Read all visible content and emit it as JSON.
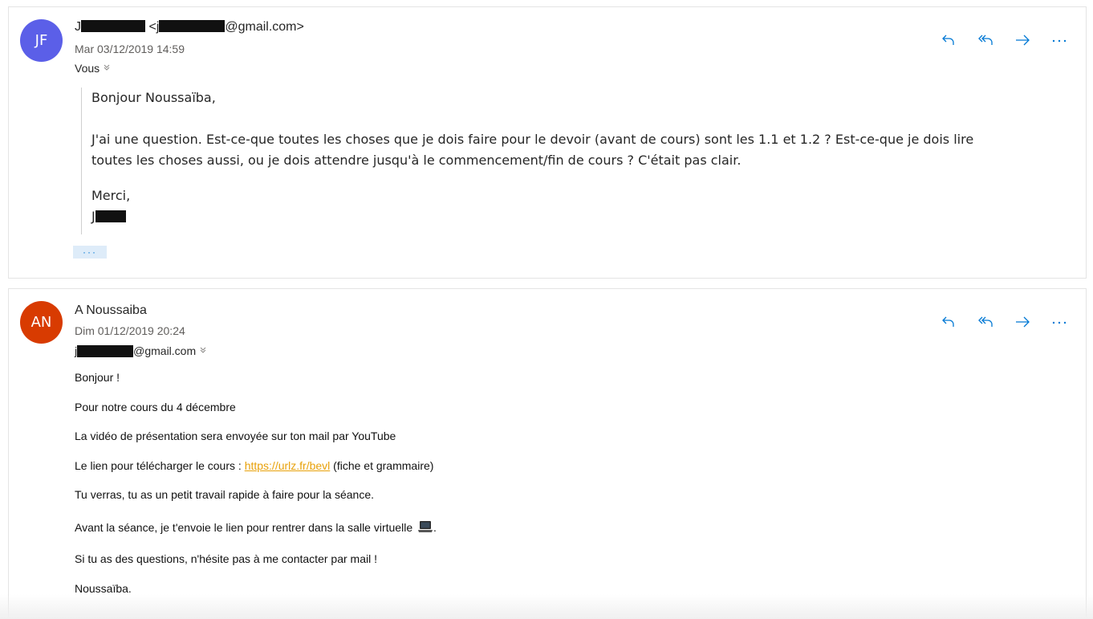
{
  "colors": {
    "accent": "#0078d4",
    "avatar1": "#5b5fe8",
    "avatar2": "#d83b01",
    "link": "#e8a10a"
  },
  "message1": {
    "avatar_initials": "JF",
    "sender_name_prefix": "J",
    "sender_email_prefix": "<j",
    "sender_email_suffix": "@gmail.com>",
    "date": "Mar 03/12/2019 14:59",
    "to_label": "Vous",
    "body": {
      "greeting": "Bonjour Noussaïba,",
      "line1": "J'ai une question. Est-ce-que toutes les choses que je dois faire pour le devoir (avant de cours) sont les 1.1 et 1.2 ? Est-ce-que je dois lire",
      "line2": "toutes les choses aussi, ou je dois attendre jusqu'à le commencement/fin de cours ? C'était pas clair.",
      "signoff": "Merci,",
      "signature_prefix": "J"
    },
    "more_label": "···",
    "actions": [
      "reply-icon",
      "reply-all-icon",
      "forward-icon",
      "more-icon"
    ]
  },
  "message2": {
    "avatar_initials": "AN",
    "sender": "A Noussaiba",
    "date": "Dim 01/12/2019 20:24",
    "to_prefix": "j",
    "to_suffix": "@gmail.com",
    "body": {
      "l1": "Bonjour !",
      "l2": "Pour notre cours du 4 décembre",
      "l3": "La vidéo de présentation sera envoyée sur ton mail par YouTube",
      "l4_prefix": "Le lien pour télécharger le cours : ",
      "l4_link": "https://urlz.fr/bevl",
      "l4_suffix": " (fiche et grammaire)",
      "l5": "Tu verras, tu as un petit travail rapide à faire pour la séance.",
      "l6": "Avant la séance, je t'envoie le lien pour rentrer dans la salle virtuelle",
      "l6_end": ".",
      "l7": "Si tu as des questions, n'hésite pas à me contacter par mail !",
      "l8": "Noussaïba."
    },
    "actions": [
      "reply-icon",
      "reply-all-icon",
      "forward-icon",
      "more-icon"
    ]
  }
}
